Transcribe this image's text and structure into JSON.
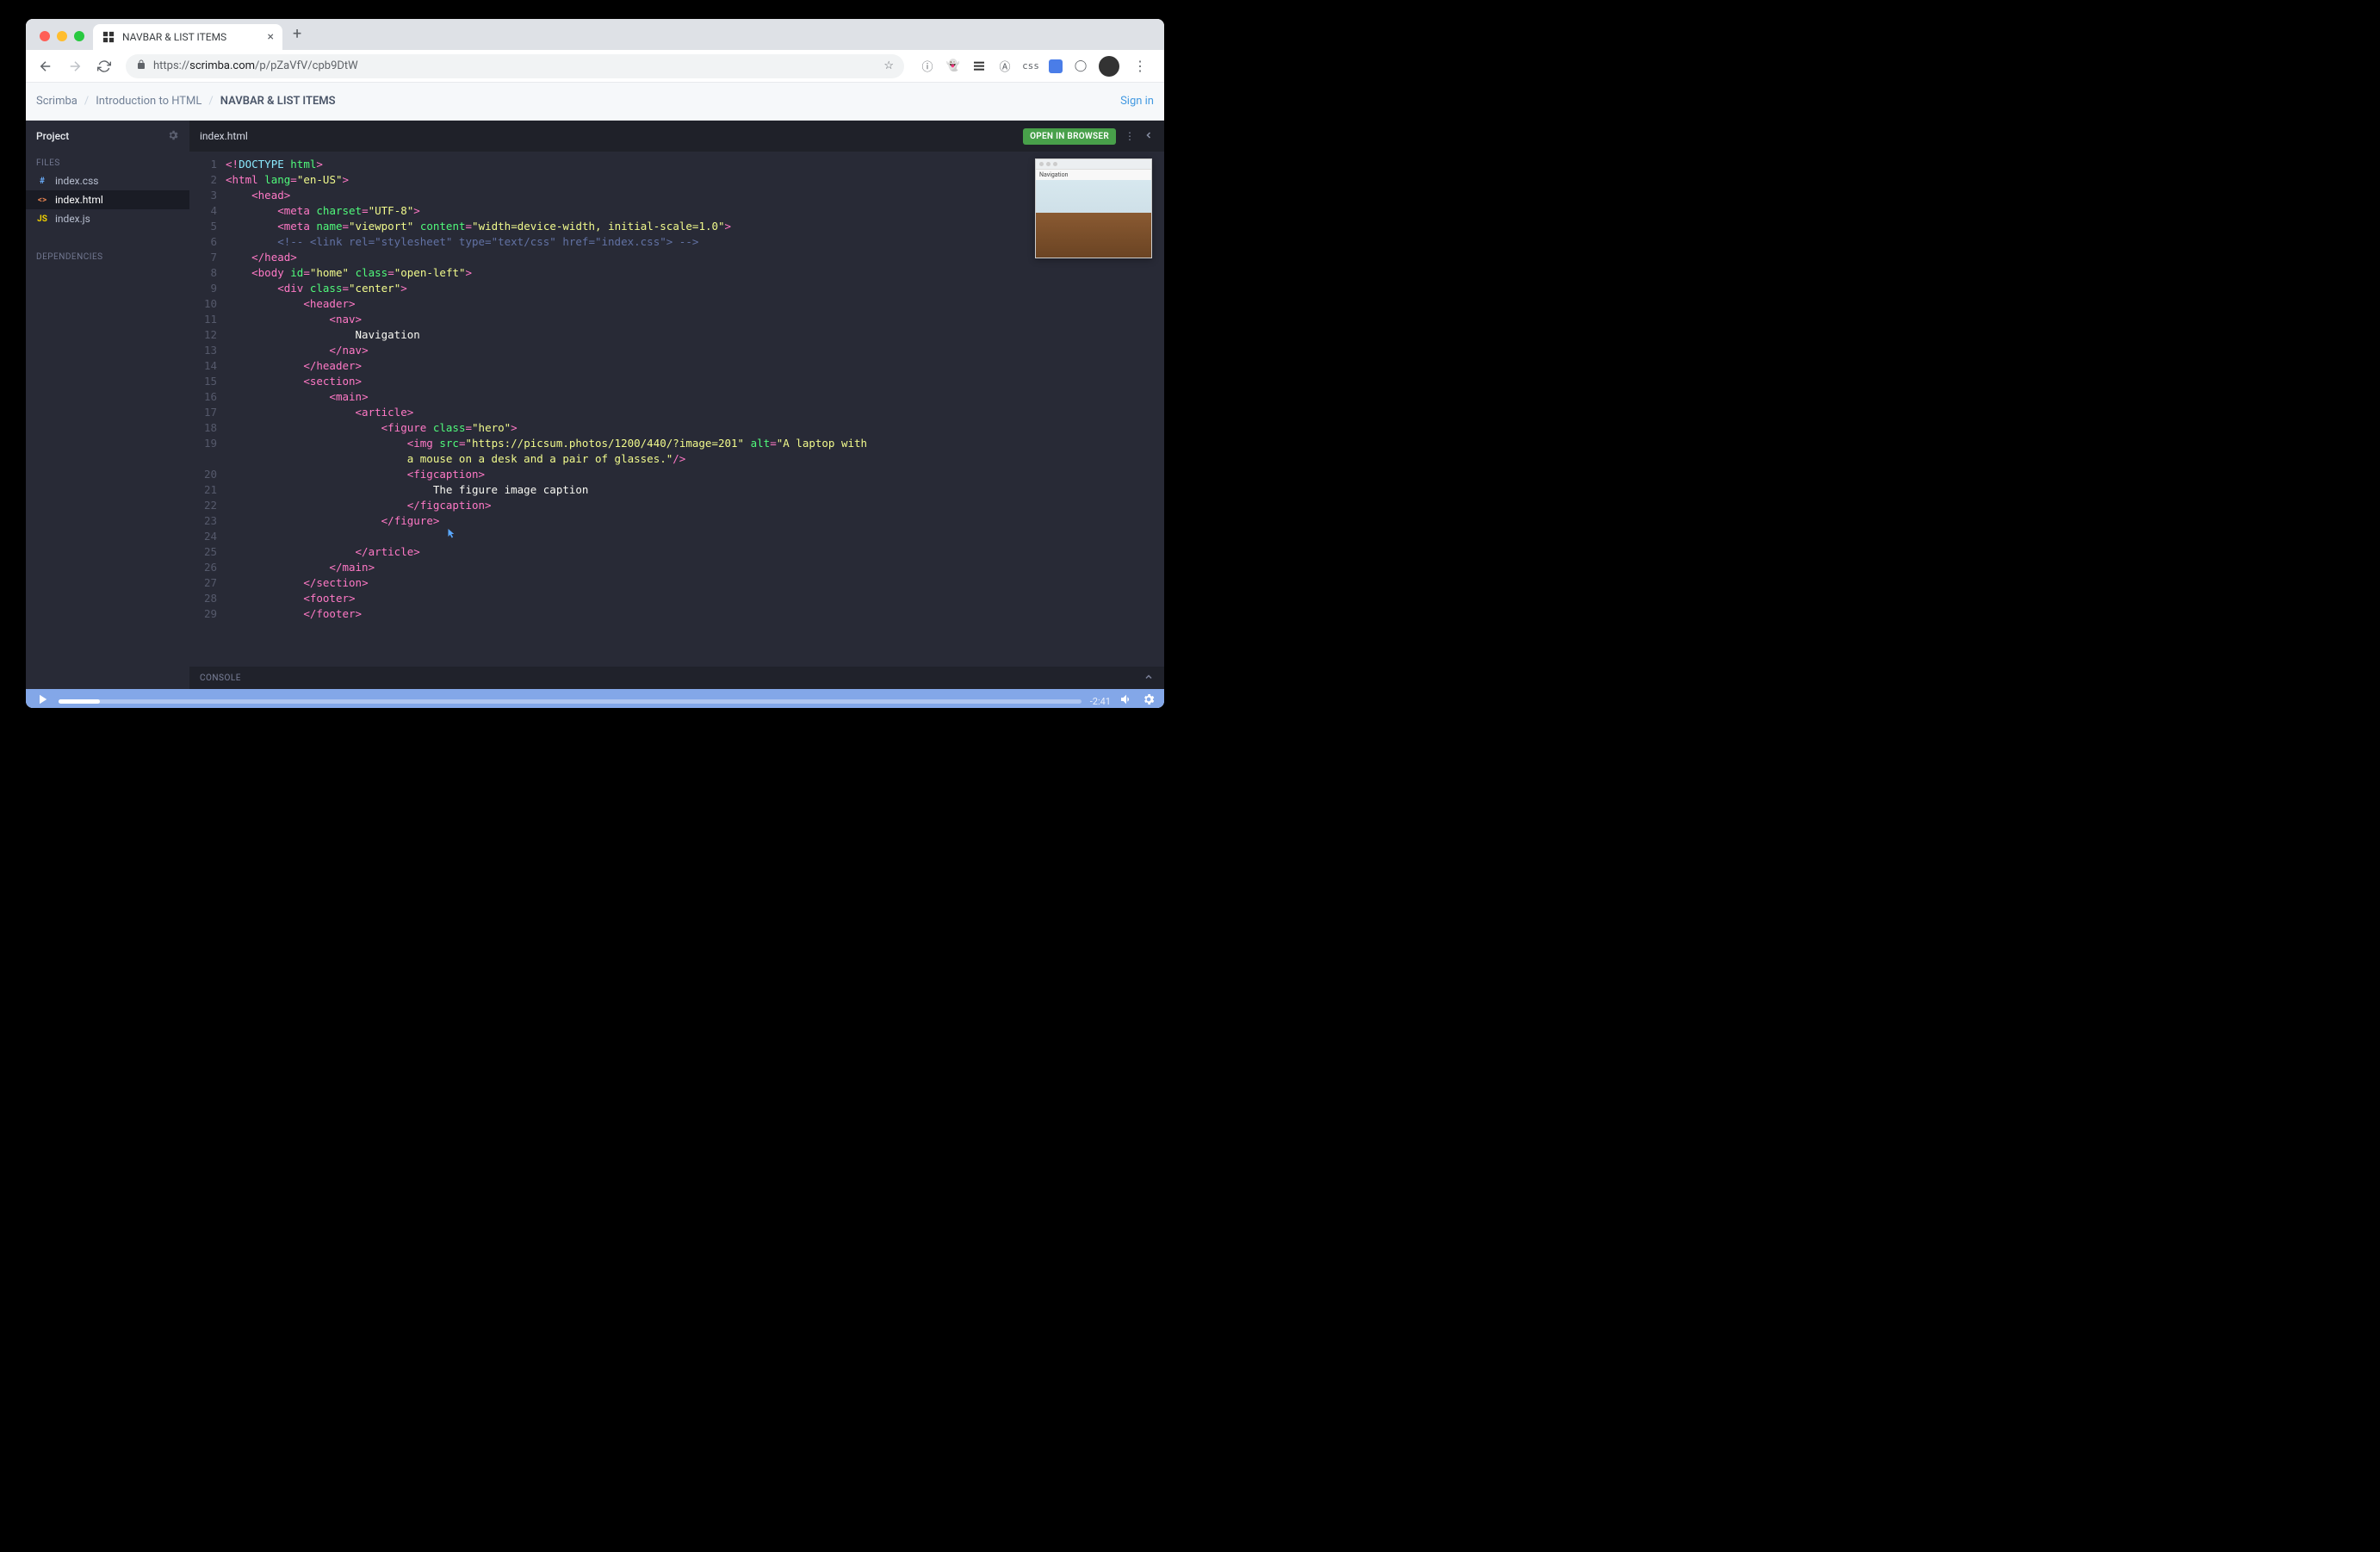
{
  "browser": {
    "tab_title": "NAVBAR & LIST ITEMS",
    "url_https": "https://",
    "url_domain": "scrimba.com",
    "url_path": "/p/pZaVfV/cpb9DtW"
  },
  "scrimba": {
    "breadcrumb": [
      "Scrimba",
      "Introduction to HTML",
      "NAVBAR & LIST ITEMS"
    ],
    "sign_in": "Sign in"
  },
  "sidebar": {
    "title": "Project",
    "files_label": "FILES",
    "deps_label": "DEPENDENCIES",
    "files": [
      {
        "icon": "#",
        "icon_class": "fi-css",
        "name": "index.css"
      },
      {
        "icon": "<>",
        "icon_class": "fi-html",
        "name": "index.html",
        "active": true
      },
      {
        "icon": "JS",
        "icon_class": "fi-js",
        "name": "index.js"
      }
    ]
  },
  "editor": {
    "tab_name": "index.html",
    "open_in_browser": "OPEN IN BROWSER",
    "console_label": "CONSOLE",
    "lines": [
      {
        "n": 1,
        "html": "<span class='p'>&lt;!</span><span class='kw'>DOCTYPE</span> <span class='attr'>html</span><span class='p'>&gt;</span>"
      },
      {
        "n": 2,
        "html": "<span class='p'>&lt;</span><span class='tag'>html</span> <span class='attr'>lang</span><span class='p'>=</span><span class='str'>\"en-US\"</span><span class='p'>&gt;</span>"
      },
      {
        "n": 3,
        "html": "    <span class='p'>&lt;</span><span class='tag'>head</span><span class='p'>&gt;</span>"
      },
      {
        "n": 4,
        "html": "        <span class='p'>&lt;</span><span class='tag'>meta</span> <span class='attr'>charset</span><span class='p'>=</span><span class='str'>\"UTF-8\"</span><span class='p'>&gt;</span>"
      },
      {
        "n": 5,
        "html": "        <span class='p'>&lt;</span><span class='tag'>meta</span> <span class='attr'>name</span><span class='p'>=</span><span class='str'>\"viewport\"</span> <span class='attr'>content</span><span class='p'>=</span><span class='str'>\"width=device-width, initial-scale=1.0\"</span><span class='p'>&gt;</span>"
      },
      {
        "n": 6,
        "html": "        <span class='cm'>&lt;!-- &lt;link rel=\"stylesheet\" type=\"text/css\" href=\"index.css\"&gt; --&gt;</span>"
      },
      {
        "n": 7,
        "html": "    <span class='p'>&lt;/</span><span class='tag'>head</span><span class='p'>&gt;</span>"
      },
      {
        "n": 8,
        "html": "    <span class='p'>&lt;</span><span class='tag'>body</span> <span class='attr'>id</span><span class='p'>=</span><span class='str'>\"home\"</span> <span class='attr'>class</span><span class='p'>=</span><span class='str'>\"open-left\"</span><span class='p'>&gt;</span>"
      },
      {
        "n": 9,
        "html": "        <span class='p'>&lt;</span><span class='tag'>div</span> <span class='attr'>class</span><span class='p'>=</span><span class='str'>\"center\"</span><span class='p'>&gt;</span>"
      },
      {
        "n": 10,
        "html": "            <span class='p'>&lt;</span><span class='tag'>header</span><span class='p'>&gt;</span>"
      },
      {
        "n": 11,
        "html": "                <span class='p'>&lt;</span><span class='tag'>nav</span><span class='p'>&gt;</span>"
      },
      {
        "n": 12,
        "html": "                    <span class='txt'>Navigation</span>"
      },
      {
        "n": 13,
        "html": "                <span class='p'>&lt;/</span><span class='tag'>nav</span><span class='p'>&gt;</span>"
      },
      {
        "n": 14,
        "html": "            <span class='p'>&lt;/</span><span class='tag'>header</span><span class='p'>&gt;</span>"
      },
      {
        "n": 15,
        "html": "            <span class='p'>&lt;</span><span class='tag'>section</span><span class='p'>&gt;</span>"
      },
      {
        "n": 16,
        "html": "                <span class='p'>&lt;</span><span class='tag'>main</span><span class='p'>&gt;</span>"
      },
      {
        "n": 17,
        "html": "                    <span class='p'>&lt;</span><span class='tag'>article</span><span class='p'>&gt;</span>"
      },
      {
        "n": 18,
        "html": "                        <span class='p'>&lt;</span><span class='tag'>figure</span> <span class='attr'>class</span><span class='p'>=</span><span class='str'>\"hero\"</span><span class='p'>&gt;</span>"
      },
      {
        "n": 19,
        "html": "                            <span class='p'>&lt;</span><span class='tag'>img</span> <span class='attr'>src</span><span class='p'>=</span><span class='str'>\"https://picsum.photos/1200/440/?image=201\"</span> <span class='attr'>alt</span><span class='p'>=</span><span class='str'>\"A laptop with </span>"
      },
      {
        "n": null,
        "html": "                            <span class='str'>a mouse on a desk and a pair of glasses.\"</span><span class='p'>/&gt;</span>"
      },
      {
        "n": 20,
        "html": "                            <span class='p'>&lt;</span><span class='tag'>figcaption</span><span class='p'>&gt;</span>"
      },
      {
        "n": 21,
        "html": "                                <span class='txt'>The figure image caption</span>"
      },
      {
        "n": 22,
        "html": "                            <span class='p'>&lt;/</span><span class='tag'>figcaption</span><span class='p'>&gt;</span>"
      },
      {
        "n": 23,
        "html": "                        <span class='p'>&lt;/</span><span class='tag'>figure</span><span class='p'>&gt;</span>"
      },
      {
        "n": 24,
        "html": ""
      },
      {
        "n": 25,
        "html": "                    <span class='p'>&lt;/</span><span class='tag'>article</span><span class='p'>&gt;</span>"
      },
      {
        "n": 26,
        "html": "                <span class='p'>&lt;/</span><span class='tag'>main</span><span class='p'>&gt;</span>"
      },
      {
        "n": 27,
        "html": "            <span class='p'>&lt;/</span><span class='tag'>section</span><span class='p'>&gt;</span>"
      },
      {
        "n": 28,
        "html": "            <span class='p'>&lt;</span><span class='tag'>footer</span><span class='p'>&gt;</span>"
      },
      {
        "n": 29,
        "html": "            <span class='p'>&lt;/</span><span class='tag'>footer</span><span class='p'>&gt;</span>"
      }
    ]
  },
  "preview": {
    "nav_text": "Navigation"
  },
  "player": {
    "time": "-2:41",
    "progress_pct": 4
  }
}
